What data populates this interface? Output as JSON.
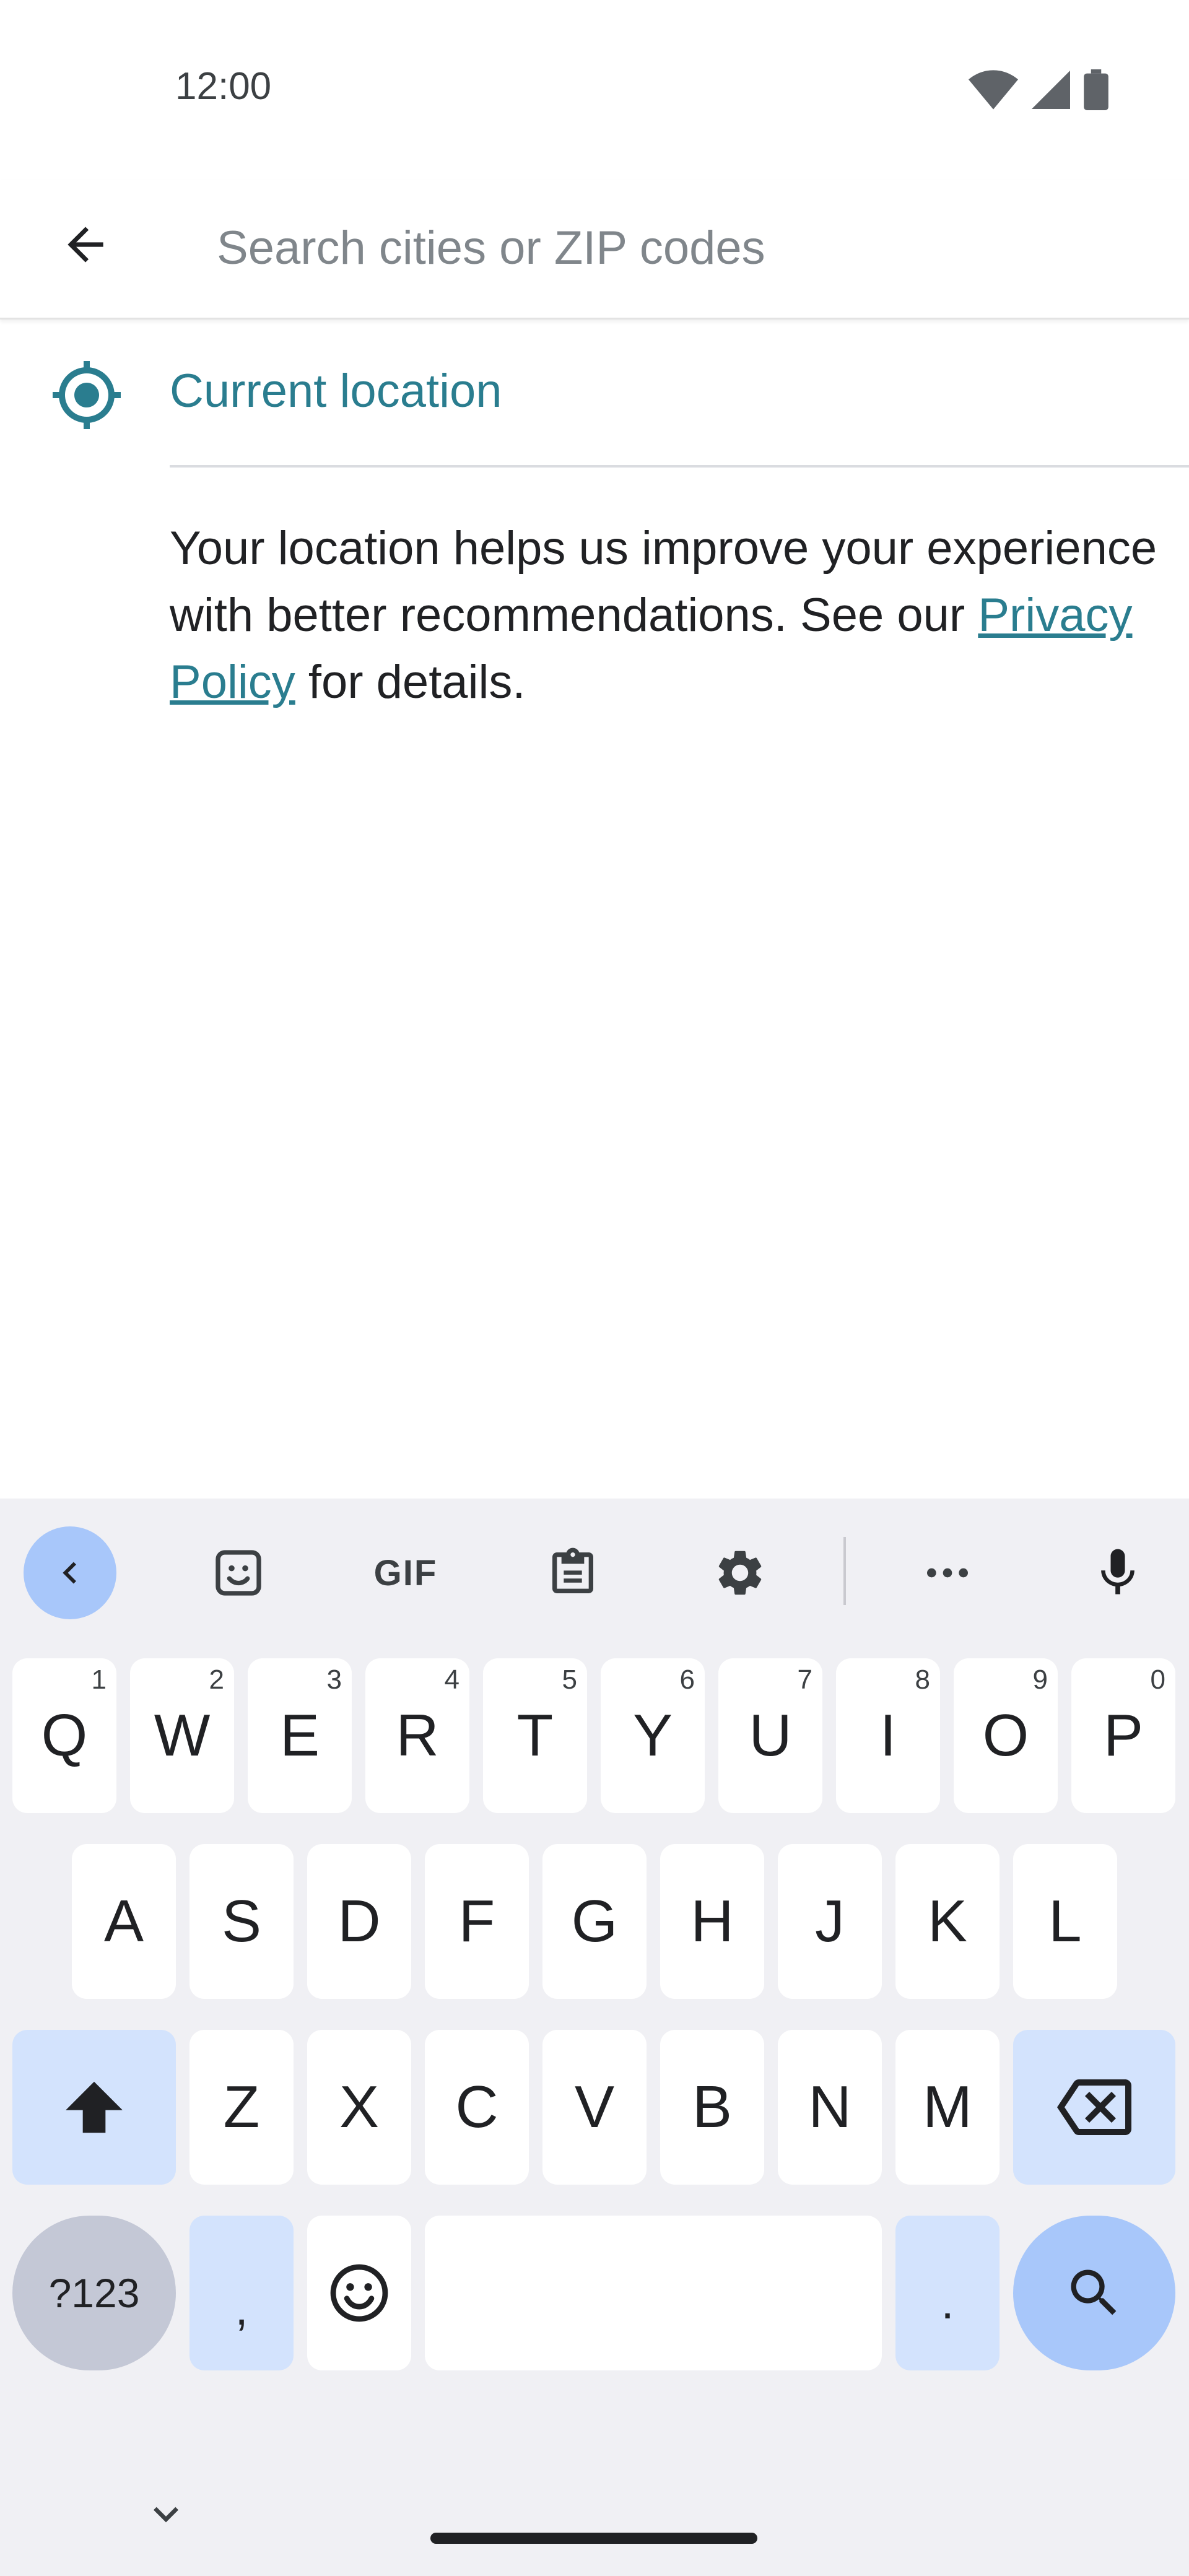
{
  "status_bar": {
    "time": "12:00",
    "icons": [
      "wifi-icon",
      "cell-signal-icon",
      "battery-icon"
    ]
  },
  "search": {
    "back_icon": "arrow-left-icon",
    "placeholder": "Search cities or ZIP codes",
    "value": ""
  },
  "current_location": {
    "icon": "my-location-icon",
    "label": "Current location"
  },
  "privacy": {
    "text_before": "Your location helps us improve your experience with better recommendations. See our ",
    "link_label": "Privacy Policy",
    "text_after": " for details."
  },
  "colors": {
    "accent": "#2a7d8f",
    "keyboard_bg": "#f0f0f4",
    "key_bg": "#ffffff",
    "modifier_key_bg": "#d3e3fd",
    "action_key_bg": "#a8c7fa"
  },
  "keyboard": {
    "toolbar": [
      "chevron-left-icon",
      "sticker-icon",
      "gif-icon",
      "clipboard-icon",
      "gear-icon",
      "more-horiz-icon",
      "mic-icon"
    ],
    "gif_label": "GIF",
    "rows": [
      [
        {
          "label": "Q",
          "hint": "1"
        },
        {
          "label": "W",
          "hint": "2"
        },
        {
          "label": "E",
          "hint": "3"
        },
        {
          "label": "R",
          "hint": "4"
        },
        {
          "label": "T",
          "hint": "5"
        },
        {
          "label": "Y",
          "hint": "6"
        },
        {
          "label": "U",
          "hint": "7"
        },
        {
          "label": "I",
          "hint": "8"
        },
        {
          "label": "O",
          "hint": "9"
        },
        {
          "label": "P",
          "hint": "0"
        }
      ],
      [
        {
          "label": "A"
        },
        {
          "label": "S"
        },
        {
          "label": "D"
        },
        {
          "label": "F"
        },
        {
          "label": "G"
        },
        {
          "label": "H"
        },
        {
          "label": "J"
        },
        {
          "label": "K"
        },
        {
          "label": "L"
        }
      ],
      [
        {
          "label": "Z"
        },
        {
          "label": "X"
        },
        {
          "label": "C"
        },
        {
          "label": "V"
        },
        {
          "label": "B"
        },
        {
          "label": "N"
        },
        {
          "label": "M"
        }
      ]
    ],
    "symbols_label": "?123",
    "comma_label": ",",
    "period_label": "."
  }
}
